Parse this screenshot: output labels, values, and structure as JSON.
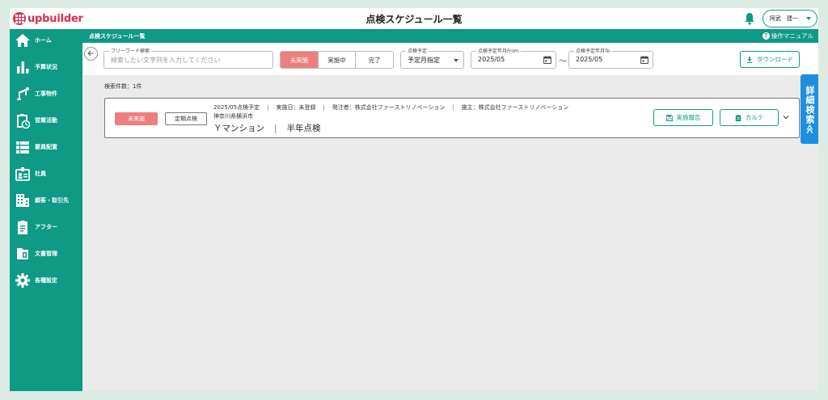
{
  "app": {
    "logo_text": "upbuilder",
    "page_title": "点検スケジュール一覧",
    "user_name": "阿武　建一"
  },
  "sidebar": {
    "items": [
      {
        "label": "ホーム",
        "icon": "home-icon"
      },
      {
        "label": "予算状況",
        "icon": "bar-chart-icon"
      },
      {
        "label": "工事物件",
        "icon": "construction-icon"
      },
      {
        "label": "営業活動",
        "icon": "clipboard-clock-icon"
      },
      {
        "label": "要員配置",
        "icon": "list-icon"
      },
      {
        "label": "社員",
        "icon": "id-badge-icon"
      },
      {
        "label": "顧客・取引先",
        "icon": "building-icon"
      },
      {
        "label": "アフター",
        "icon": "clipboard-icon"
      },
      {
        "label": "文書管理",
        "icon": "document-icon"
      },
      {
        "label": "各種設定",
        "icon": "gear-icon"
      }
    ]
  },
  "subheader": {
    "title": "点検スケジュール一覧",
    "manual_link": "操作マニュアル"
  },
  "search": {
    "freeword_label": "フリーワード検索",
    "freeword_placeholder": "検索したい文字列を入力してください",
    "status_options": [
      "未実施",
      "実施中",
      "完了"
    ],
    "status_selected": "未実施",
    "schedule_label": "点検予定",
    "schedule_value": "予定月指定",
    "from_label": "点検予定年月From",
    "from_value": "2025/05",
    "range_separator": "〜",
    "to_label": "点検予定年月To",
    "to_value": "2025/05",
    "download_label": "ダウンロード",
    "advanced_search_label": "詳細検索≪"
  },
  "results": {
    "count_text": "検索件数：1件",
    "items": [
      {
        "status": "未実施",
        "type": "定期点検",
        "schedule": "2025/05点検予定",
        "executed": "実施日：未登録",
        "orderer": "発注者：株式会社ファーストリノベーション",
        "client": "施主：株式会社ファーストリノベーション",
        "address": "神奈川県横浜市",
        "property": "Ｙマンション",
        "inspection": "半年点検",
        "report_button": "実施報告",
        "chart_button": "カルテ"
      }
    ]
  },
  "colors": {
    "primary": "#0e9a85",
    "status_red": "#ef7f7f",
    "accent_blue": "#1d8fe0",
    "brand_red": "#d6304d"
  }
}
